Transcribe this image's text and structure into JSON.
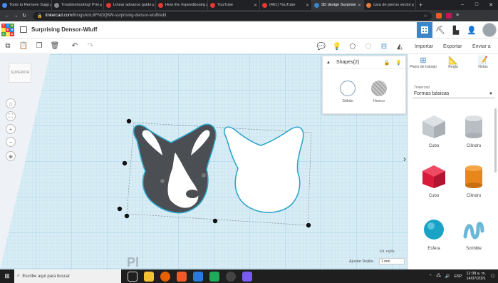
{
  "browser": {
    "tabs": [
      {
        "title": "Tools to Remove Supp",
        "color": "#4a8af4"
      },
      {
        "title": "Troubleshooting! Prin",
        "color": "#888888"
      },
      {
        "title": "Linear advance guide",
        "color": "#e53935"
      },
      {
        "title": "How the #speedboatrg",
        "color": "#e53935"
      },
      {
        "title": "YouTube",
        "color": "#e53935"
      },
      {
        "title": "(461) YouTube",
        "color": "#e53935"
      },
      {
        "title": "3D design Surprisin",
        "color": "#3a86c8",
        "active": true
      },
      {
        "title": "cara de perros vector",
        "color": "#e07b39"
      }
    ],
    "url_host": "tinkercad.com",
    "url_path": "/things/knL6FNOQ6W-surprising-densor-wluff/edit",
    "new_tab": "+",
    "window_controls": [
      "–",
      "□",
      "✕"
    ]
  },
  "app": {
    "logo_letters": [
      "T",
      "I",
      "N",
      "K",
      "E",
      "R",
      "C",
      "A",
      "D"
    ],
    "logo_colors": [
      "#e53935",
      "#1e88e5",
      "#43a047",
      "#fdd835",
      "#e53935",
      "#1e88e5",
      "#43a047",
      "#fdd835",
      "#e53935"
    ],
    "design_title": "Surprising Densor-Wluff",
    "header_actions": [
      "Importar",
      "Exportar",
      "Enviar a"
    ]
  },
  "workplane": {
    "viewcube_label": "SUPERIOR",
    "edit_grid": "Ed. rejilla",
    "snap_label": "Ajustar Rejilla",
    "snap_value": "1 mm",
    "watermark": "Pl"
  },
  "inspector": {
    "title": "Shapes(2)",
    "solid_label": "Sólido",
    "hole_label": "Hueco"
  },
  "panel": {
    "tools": [
      {
        "label": "Plano de trabajo",
        "icon": "workplane-icon"
      },
      {
        "label": "Regla",
        "icon": "ruler-icon"
      },
      {
        "label": "Notas",
        "icon": "notes-icon"
      }
    ],
    "library_source": "Tinkercad",
    "library": "Formas básicas",
    "shapes": [
      {
        "label": "Cubo",
        "color": "#b8bec4"
      },
      {
        "label": "Cilindro",
        "color": "#b8bec4"
      },
      {
        "label": "Cubo",
        "color": "#d81b3b"
      },
      {
        "label": "Cilindro",
        "color": "#e8861d"
      },
      {
        "label": "Esfera",
        "color": "#1aa3c6"
      },
      {
        "label": "Scribble",
        "color": "#6ab8d6"
      }
    ]
  },
  "taskbar": {
    "search_placeholder": "Escribe aquí para buscar",
    "language": "ESP",
    "time": "12:38 a. m.",
    "date": "14/07/2021"
  }
}
